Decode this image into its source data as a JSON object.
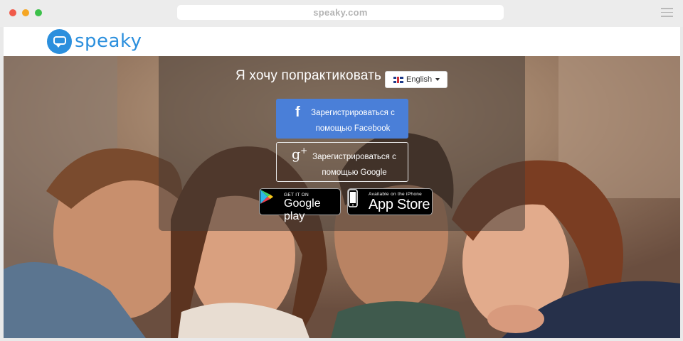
{
  "browser": {
    "url": "speaky.com"
  },
  "brand": {
    "name": "speaky",
    "color": "#2b8fdd"
  },
  "hero": {
    "headline": "Я хочу попрактиковать",
    "language": {
      "selected": "English"
    },
    "facebook_button": {
      "line1": "Зарегистрироваться с",
      "line2": "помощью Facebook",
      "color": "#4a7fd8"
    },
    "google_button": {
      "line1": "Зарегистрироваться с",
      "line2": "помощью Google"
    },
    "google_play": {
      "small": "GET IT ON",
      "big": "Google play"
    },
    "app_store": {
      "small": "Available on the iPhone",
      "big": "App Store"
    }
  },
  "icons": [
    "menu-icon",
    "speaky-logo-icon",
    "uk-flag-icon",
    "dropdown-caret-icon",
    "facebook-icon",
    "google-plus-icon",
    "google-play-icon",
    "apple-icon"
  ]
}
